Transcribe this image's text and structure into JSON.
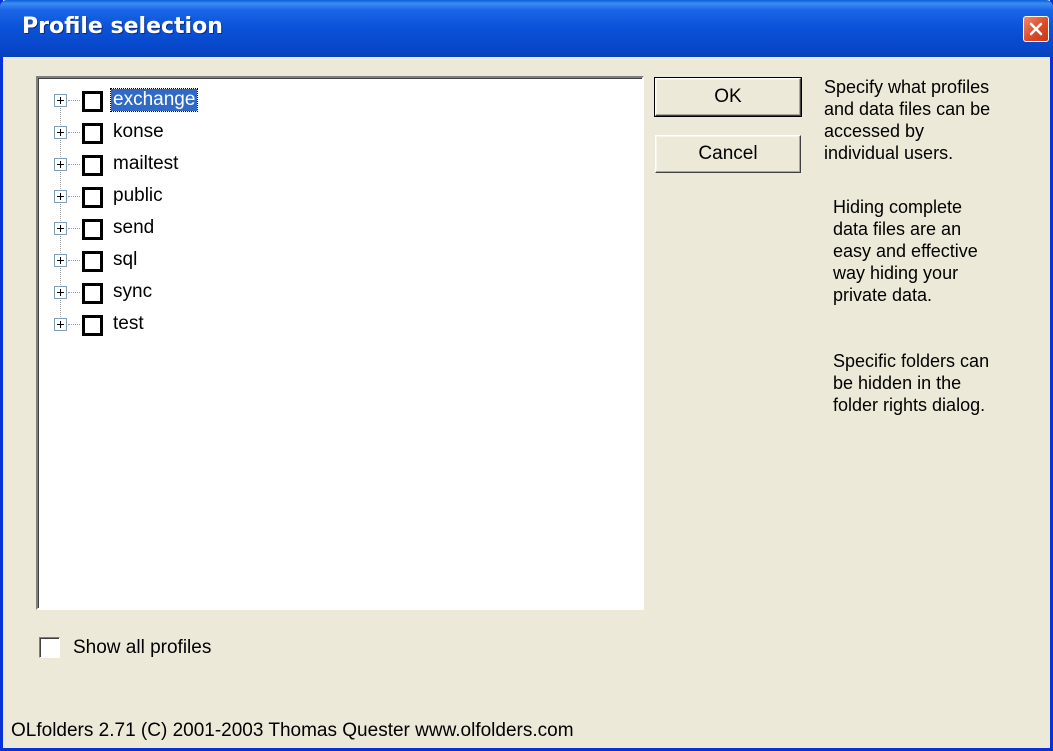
{
  "window": {
    "title": "Profile selection"
  },
  "tree": {
    "items": [
      {
        "label": "exchange",
        "checked": false,
        "selected": true
      },
      {
        "label": "konse",
        "checked": false,
        "selected": false
      },
      {
        "label": "mailtest",
        "checked": false,
        "selected": false
      },
      {
        "label": "public",
        "checked": false,
        "selected": false
      },
      {
        "label": "send",
        "checked": false,
        "selected": false
      },
      {
        "label": "sql",
        "checked": false,
        "selected": false
      },
      {
        "label": "sync",
        "checked": false,
        "selected": false
      },
      {
        "label": "test",
        "checked": false,
        "selected": false
      }
    ]
  },
  "buttons": {
    "ok_label": "OK",
    "cancel_label": "Cancel"
  },
  "help": {
    "p1": "Specify what profiles\nand data files can be\naccessed by\nindividual users.",
    "p2": "Hiding complete\ndata files are an\neasy and effective\nway hiding your\nprivate data.",
    "p3": "Specific folders can\nbe hidden in the\nfolder rights dialog."
  },
  "options": {
    "show_all_label": "Show all profiles",
    "show_all_checked": false
  },
  "footer": {
    "text": "OLfolders 2.71 (C) 2001-2003 Thomas Quester www.olfolders.com"
  },
  "colors": {
    "titlebar": "#0a52d8",
    "selection": "#316ac5",
    "dialog_bg": "#ece9d8"
  }
}
